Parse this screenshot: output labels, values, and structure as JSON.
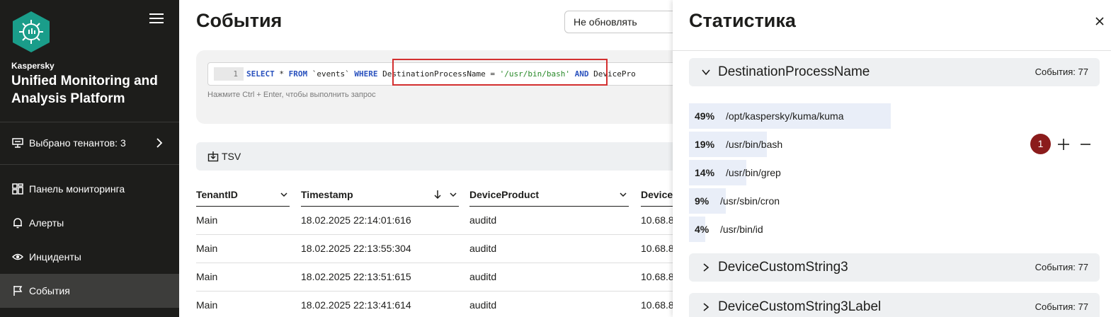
{
  "sidebar": {
    "brand_small": "Kaspersky",
    "brand_title": "Unified Monitoring and Analysis Platform",
    "tenants_label": "Выбрано тенантов: 3",
    "nav": [
      {
        "label": "Панель мониторинга",
        "icon": "dashboard-icon"
      },
      {
        "label": "Алерты",
        "icon": "bell-icon"
      },
      {
        "label": "Инциденты",
        "icon": "eye-icon"
      },
      {
        "label": "События",
        "icon": "flag-icon",
        "active": true
      }
    ]
  },
  "main": {
    "title": "События",
    "refresh_select": "Не обновлять",
    "query": {
      "line_number": "1",
      "t1": "SELECT",
      "t2": " * ",
      "t3": "FROM",
      "t4": " `events` ",
      "t5": "WHERE",
      "t6": "  DestinationProcessName = ",
      "t7": "'/usr/bin/bash'",
      "t8": " ",
      "t9": "AND",
      "t10": " DevicePro"
    },
    "hint": "Нажмите Ctrl + Enter, чтобы выполнить запрос",
    "export_label": "TSV",
    "columns": [
      "TenantID",
      "Timestamp",
      "DeviceProduct",
      "Device"
    ],
    "rows": [
      [
        "Main",
        "18.02.2025 22:14:01:616",
        "auditd",
        "10.68.8"
      ],
      [
        "Main",
        "18.02.2025 22:13:55:304",
        "auditd",
        "10.68.8"
      ],
      [
        "Main",
        "18.02.2025 22:13:51:615",
        "auditd",
        "10.68.8"
      ],
      [
        "Main",
        "18.02.2025 22:13:41:614",
        "auditd",
        "10.68.8"
      ]
    ]
  },
  "stats": {
    "title": "Статистика",
    "groups": [
      {
        "name": "DestinationProcessName",
        "count": "События: 77",
        "expanded": true,
        "values": [
          {
            "pct": "49%",
            "value": "/opt/kaspersky/kuma/kuma",
            "share": 0.49
          },
          {
            "pct": "19%",
            "value": "/usr/bin/bash",
            "share": 0.19
          },
          {
            "pct": "14%",
            "value": "/usr/bin/grep",
            "share": 0.14
          },
          {
            "pct": "9%",
            "value": "/usr/sbin/cron",
            "share": 0.09
          },
          {
            "pct": "4%",
            "value": "/usr/bin/id",
            "share": 0.04
          }
        ]
      },
      {
        "name": "DeviceCustomString3",
        "count": "События: 77",
        "expanded": false
      },
      {
        "name": "DeviceCustomString3Label",
        "count": "События: 77",
        "expanded": false
      }
    ],
    "callout_number": "1"
  },
  "colors": {
    "sidebar_bg": "#1d1d1b",
    "accent_highlight": "#d32f2f",
    "badge": "#8b1c1c",
    "bar_fill": "#e9eef8"
  }
}
